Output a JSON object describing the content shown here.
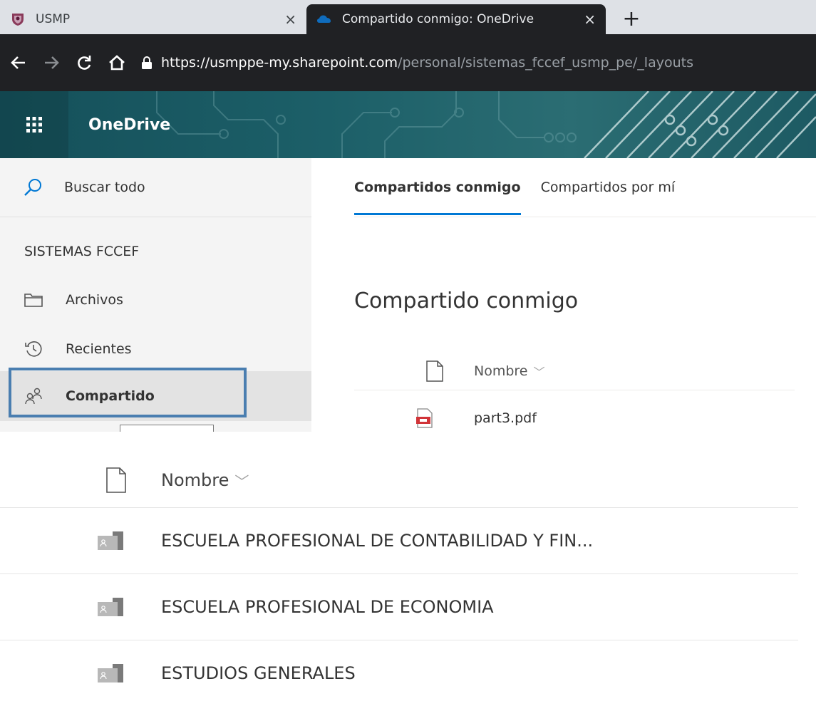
{
  "browser": {
    "tabs": [
      {
        "title": "USMP",
        "close": "×",
        "active": false,
        "favicon": "usmp-crest-icon"
      },
      {
        "title": "Compartido conmigo: OneDrive",
        "close": "×",
        "active": true,
        "favicon": "onedrive-cloud-icon"
      }
    ],
    "new_tab": "+",
    "url_host": "https://usmppe-my.sharepoint.com",
    "url_path": "/personal/sistemas_fccef_usmp_pe/_layouts"
  },
  "header": {
    "app_name": "OneDrive",
    "colors": {
      "header_bg": "#1c5f68",
      "accent": "#0078d4",
      "highlight_border": "#4a7eb0"
    }
  },
  "sidebar": {
    "search_label": "Buscar todo",
    "section_title": "SISTEMAS FCCEF",
    "items": [
      {
        "label": "Archivos",
        "icon": "folder-icon"
      },
      {
        "label": "Recientes",
        "icon": "history-icon"
      },
      {
        "label": "Compartido",
        "icon": "people-icon",
        "selected": true
      }
    ]
  },
  "main": {
    "tabs": [
      {
        "label": "Compartidos conmigo",
        "active": true
      },
      {
        "label": "Compartidos por mí",
        "active": false
      }
    ],
    "title": "Compartido conmigo",
    "column_name": "Nombre",
    "files": [
      {
        "name": "part3.pdf",
        "icon": "pdf-icon"
      }
    ]
  },
  "shared_list": {
    "column_name": "Nombre",
    "folders": [
      {
        "name": "ESCUELA PROFESIONAL DE CONTABILIDAD Y FIN..."
      },
      {
        "name": "ESCUELA PROFESIONAL DE ECONOMIA"
      },
      {
        "name": "ESTUDIOS GENERALES"
      }
    ]
  }
}
